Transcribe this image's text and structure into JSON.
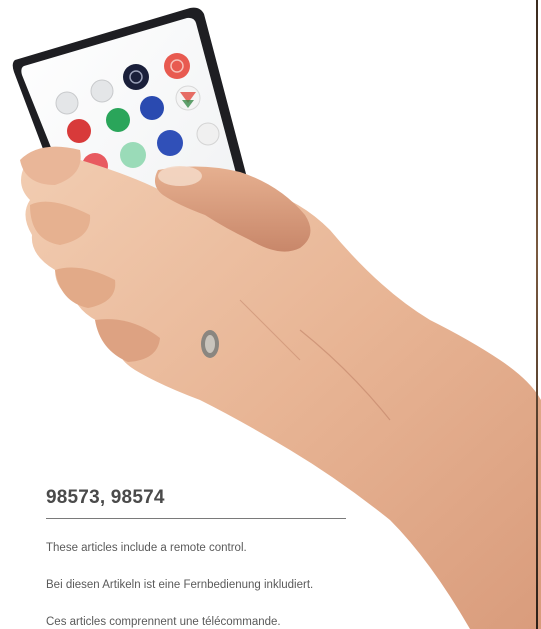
{
  "caption": {
    "article_numbers": "98573, 98574",
    "lines": [
      "These articles include a remote control.",
      "Bei diesen Artikeln ist eine Fernbedienung inkludiert.",
      "Ces articles comprennent une télécommande."
    ]
  },
  "remote_buttons": [
    {
      "color": "#e8e8e8",
      "icon": "brightness-up-icon"
    },
    {
      "color": "#e8e8e8",
      "icon": "brightness-down-icon"
    },
    {
      "color": "#1a1f3a",
      "icon": "power-off-icon"
    },
    {
      "color": "#e85a50",
      "icon": "power-on-icon"
    },
    {
      "color": "#d83a3a",
      "icon": "red-icon"
    },
    {
      "color": "#2aa55a",
      "icon": "green-icon"
    },
    {
      "color": "#2a4ab0",
      "icon": "blue-icon"
    },
    {
      "color": "#f0f0f0",
      "icon": "white-icon"
    },
    {
      "color": "#e85a60"
    },
    {
      "color": "#6bcf95"
    },
    {
      "color": "#3050b8"
    },
    {
      "color": "#e87a40"
    },
    {
      "color": "#48b8d8"
    },
    {
      "color": "#f0d030"
    },
    {
      "color": "#2a80d8"
    },
    {
      "color": "#e04a70"
    },
    {
      "color": "#f0e060"
    },
    {
      "color": "#38a0e8"
    }
  ]
}
